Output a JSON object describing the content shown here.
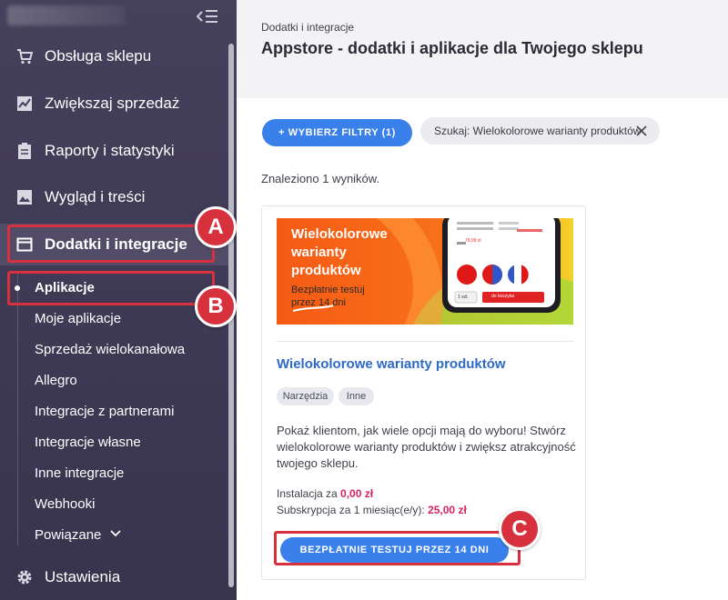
{
  "sidebar": {
    "items": [
      {
        "label": "Obsługa sklepu",
        "icon": "cart-icon"
      },
      {
        "label": "Zwiększaj sprzedaż",
        "icon": "chart-line-icon"
      },
      {
        "label": "Raporty i statystyki",
        "icon": "clipboard-icon"
      },
      {
        "label": "Wygląd i treści",
        "icon": "image-icon"
      },
      {
        "label": "Dodatki i integracje",
        "icon": "window-icon"
      }
    ],
    "sub_items": [
      "Aplikacje",
      "Moje aplikacje",
      "Sprzedaż wielokanałowa",
      "Allegro",
      "Integracje z partnerami",
      "Integracje własne",
      "Inne integracje",
      "Webhooki",
      "Powiązane"
    ],
    "settings_label": "Ustawienia"
  },
  "annotations": {
    "a": "A",
    "b": "B",
    "c": "C",
    "color": "#d6313c"
  },
  "header": {
    "breadcrumb": "Dodatki i integracje",
    "title": "Appstore - dodatki i aplikacje dla Twojego sklepu"
  },
  "filters": {
    "button_label": "+ WYBIERZ FILTRY (1)",
    "search_chip": "Szukaj: Wielokolorowe warianty produktów"
  },
  "results_text": "Znaleziono 1 wyników.",
  "card": {
    "banner": {
      "title_line1": "Wielokolorowe",
      "title_line2": "warianty",
      "title_line3": "produktów",
      "sub_line1": "Bezpłatnie testuj",
      "sub_line2": "przez 14 dni",
      "phone_price": "79,99 zł",
      "phone_button": "do koszyka",
      "phone_qty": "1 szt."
    },
    "title": "Wielokolorowe warianty produktów",
    "tags": [
      "Narzędzia",
      "Inne"
    ],
    "description": "Pokaż klientom, jak wiele opcji mają do wyboru! Stwórz wielokolorowe warianty produktów i zwiększ atrakcyjność twojego sklepu.",
    "install_label": "Instalacja za",
    "install_price": "0,00 zł",
    "subscription_label": "Subskrypcja za 1 miesiąc(e/y):",
    "subscription_price": "25,00 zł",
    "cta_label": "BEZPŁATNIE TESTUJ PRZEZ 14 DNI"
  },
  "colors": {
    "accent": "#3a80ea",
    "sidebar_bg": "#3f3a55",
    "price": "#d6245e",
    "banner_orange": "#f45c17"
  }
}
